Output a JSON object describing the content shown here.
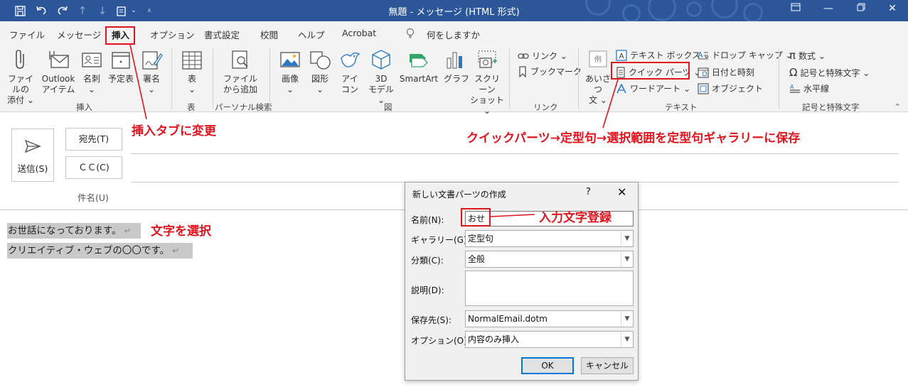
{
  "window": {
    "title": "無題  -  メッセージ (HTML 形式)",
    "colors": {
      "titlebar": "#2b579a",
      "accent": "#2b579a",
      "annotation": "#e0141e",
      "selection": "#c9c9c9"
    }
  },
  "quick_access": [
    "save-icon",
    "undo-icon",
    "redo-icon",
    "arrow-up-icon",
    "arrow-down-icon",
    "clipboard-icon",
    "customize-icon"
  ],
  "menu": {
    "tabs": [
      "ファイル",
      "メッセージ",
      "挿入",
      "オプション",
      "書式設定",
      "校閲",
      "ヘルプ",
      "Acrobat"
    ],
    "active_tab": "挿入",
    "tell_me": "何をしますか"
  },
  "ribbon": {
    "attach_file": "ファイルの\n添付 ⌄",
    "outlook_item": "Outlook\nアイテム",
    "business_card": "名刺\n⌄",
    "calendar": "予定表",
    "signature": "署名\n⌄",
    "table": "表\n⌄",
    "add_from_file": "ファイル\nから追加",
    "picture": "画像\n⌄",
    "shapes": "図形\n⌄",
    "icons": "アイ\nコン",
    "models_3d": "3D\nモデル ⌄",
    "smartart": "SmartArt",
    "chart": "グラフ",
    "screenshot": "スクリーン\nショット ⌄",
    "link": "リンク ⌄",
    "bookmark": "ブックマーク",
    "greeting": "あいさつ\n文 ⌄",
    "text_box": "テキスト ボックス ⌄",
    "quick_parts": "クイック パーツ ⌄",
    "wordart": "ワードアート ⌄",
    "drop_cap": "ドロップ キャップ ⌄",
    "date_time": "日付と時刻",
    "object": "オブジェクト",
    "equation": "数式 ⌄",
    "symbol": "記号と特殊文字 ⌄",
    "horizontal_line": "水平線",
    "groups": [
      "挿入",
      "表",
      "パーソナル検索",
      "図",
      "リンク",
      "テキスト",
      "記号と特殊文字"
    ]
  },
  "compose": {
    "send": "送信(S)",
    "to": "宛先(T)",
    "cc": "ＣＣ(C)",
    "subject": "件名(U)",
    "body_lines": [
      "お世話になっております。",
      "クリエイティブ・ウェブの〇〇です。"
    ],
    "return_mark": "↵"
  },
  "dialog": {
    "title": "新しい文書パーツの作成",
    "help": "?",
    "close": "✕",
    "name_label": "名前(N):",
    "name_value": "おせ",
    "gallery_label": "ギャラリー(G):",
    "gallery_value": "定型句",
    "category_label": "分類(C):",
    "category_value": "全般",
    "description_label": "説明(D):",
    "save_in_label": "保存先(S):",
    "save_in_value": "NormalEmail.dotm",
    "options_label": "オプション(O):",
    "options_value": "内容のみ挿入",
    "ok": "OK",
    "cancel": "キャンセル"
  },
  "annotations": {
    "change_tab": "挿入タブに変更",
    "quick_parts_path": "クイックパーツ→定型句→選択範囲を定型句ギャラリーに保存",
    "select_text": "文字を選択",
    "name_entry": "入力文字登録"
  }
}
